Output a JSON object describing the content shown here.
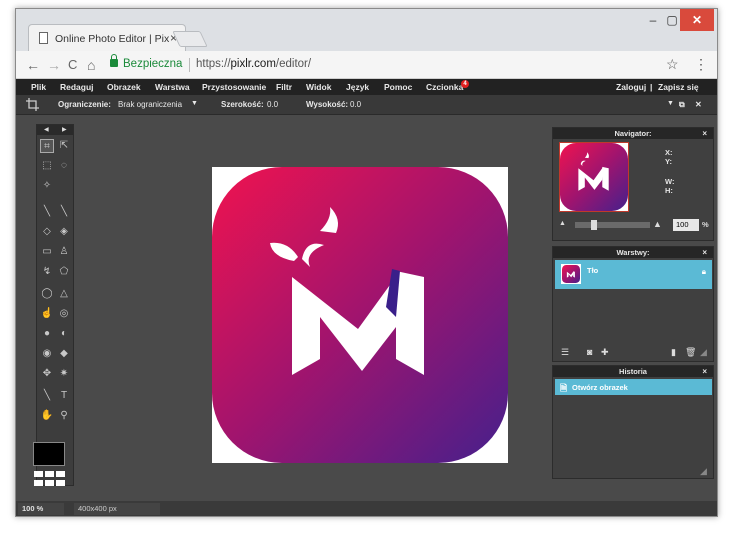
{
  "browser": {
    "tab_title": "Online Photo Editor | Pix",
    "tab_close": "×",
    "secure_label": "Bezpieczna",
    "url_scheme": "https://",
    "url_host": "pixlr.com",
    "url_path": "/editor/",
    "back": "←",
    "forward": "→",
    "reload": "C",
    "home": "⌂",
    "star": "☆",
    "menu": "⋮",
    "win_min": "–",
    "win_max": "▢",
    "win_close": "✕"
  },
  "menubar": {
    "items": [
      "Plik",
      "Redaguj",
      "Obrazek",
      "Warstwa",
      "Przystosowanie",
      "Filtr",
      "Widok",
      "Język",
      "Pomoc",
      "Czcionka"
    ],
    "font_badge": "4",
    "login": "Zaloguj",
    "divider": "|",
    "signup": "Zapisz się"
  },
  "tool_options": {
    "constraint_label": "Ograniczenie:",
    "constraint_value": "Brak ograniczenia",
    "width_label": "Szerokość:",
    "width_value": "0.0",
    "height_label": "Wysokość:",
    "height_value": "0.0"
  },
  "navigator": {
    "title": "Navigator:",
    "x_label": "X:",
    "y_label": "Y:",
    "w_label": "W:",
    "h_label": "H:",
    "zoom_value": "100",
    "zoom_unit": "%",
    "close": "×"
  },
  "layers": {
    "title": "Warstwy:",
    "close": "×",
    "layer_name": "Tło"
  },
  "history": {
    "title": "Historia",
    "close": "×",
    "item": "Otwórz obrazek"
  },
  "status": {
    "zoom": "100",
    "zoom_unit": "%",
    "dimensions": "400x400 px"
  },
  "colors": {
    "accent": "#5bbad5",
    "logo_top": "#f0134f",
    "logo_bottom": "#45208c"
  }
}
